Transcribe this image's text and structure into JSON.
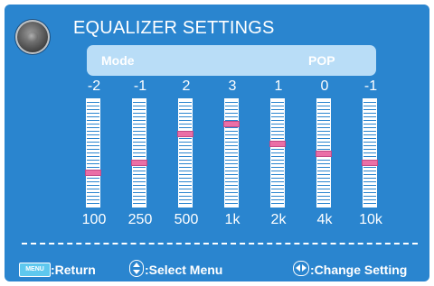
{
  "header": {
    "title": "EQUALIZER SETTINGS",
    "icon": "speaker-icon"
  },
  "mode": {
    "label": "Mode",
    "value": "POP"
  },
  "equalizer": {
    "range": [
      -5,
      5
    ],
    "bands": [
      {
        "freq": "100",
        "value": "-2",
        "level": -2
      },
      {
        "freq": "250",
        "value": "-1",
        "level": -1
      },
      {
        "freq": "500",
        "value": "2",
        "level": 2
      },
      {
        "freq": "1k",
        "value": "3",
        "level": 3
      },
      {
        "freq": "2k",
        "value": "1",
        "level": 1
      },
      {
        "freq": "4k",
        "value": "0",
        "level": 0
      },
      {
        "freq": "10k",
        "value": "-1",
        "level": -1
      }
    ]
  },
  "footer": {
    "menu_key": "MENU",
    "return_label": ":Return",
    "select_label": ":Select Menu",
    "change_label": ":Change Setting",
    "updown_icon": "up-down-arrows-icon",
    "leftright_icon": "left-right-arrows-icon"
  },
  "colors": {
    "background": "#2a85cf",
    "mode_bar": "#b9ddf7",
    "thumb": "#ea6fa6",
    "text": "#ffffff"
  }
}
